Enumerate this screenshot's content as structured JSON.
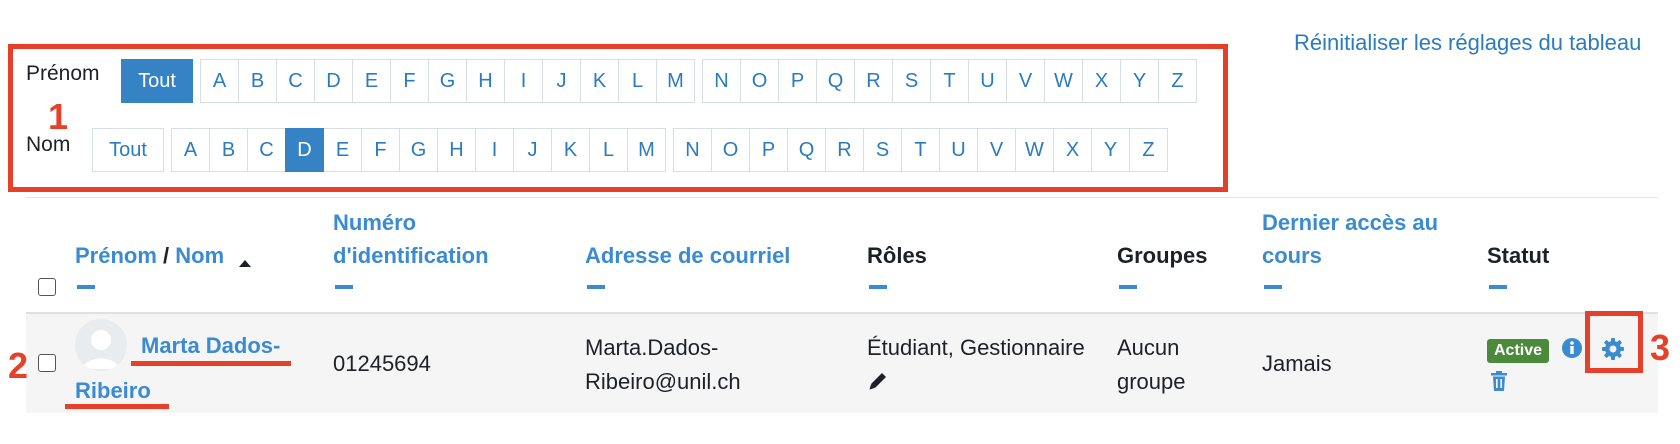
{
  "reset_link": "Réinitialiser les réglages du tableau",
  "filters": {
    "first_name": {
      "label": "Prénom",
      "tout": "Tout",
      "active": "Tout",
      "letters_a_m": [
        "A",
        "B",
        "C",
        "D",
        "E",
        "F",
        "G",
        "H",
        "I",
        "J",
        "K",
        "L",
        "M"
      ],
      "letters_n_z": [
        "N",
        "O",
        "P",
        "Q",
        "R",
        "S",
        "T",
        "U",
        "V",
        "W",
        "X",
        "Y",
        "Z"
      ]
    },
    "last_name": {
      "label": "Nom",
      "tout": "Tout",
      "active": "D",
      "letters_a_m": [
        "A",
        "B",
        "C",
        "D",
        "E",
        "F",
        "G",
        "H",
        "I",
        "J",
        "K",
        "L",
        "M"
      ],
      "letters_n_z": [
        "N",
        "O",
        "P",
        "Q",
        "R",
        "S",
        "T",
        "U",
        "V",
        "W",
        "X",
        "Y",
        "Z"
      ]
    }
  },
  "table": {
    "headers": {
      "prenom": "Prénom",
      "slash": "/",
      "nom": "Nom",
      "sort_icon": "sort-up-icon",
      "id_line1": "Numéro",
      "id_line2": "d'identification",
      "email": "Adresse de courriel",
      "roles": "Rôles",
      "groups": "Groupes",
      "last_access_line1": "Dernier accès au",
      "last_access_line2": "cours",
      "status": "Statut"
    },
    "row": {
      "name_line1": "Marta Dados-",
      "name_line2": "Ribeiro",
      "id_number": "01245694",
      "email_line1": "Marta.Dados-",
      "email_line2": "Ribeiro@unil.ch",
      "roles": "Étudiant, Gestionnaire",
      "groups_line1": "Aucun",
      "groups_line2": "groupe",
      "last_access": "Jamais",
      "status_badge": "Active",
      "icons": [
        "pencil-icon",
        "info-icon",
        "gear-icon",
        "trash-icon"
      ]
    }
  },
  "annotations": {
    "one": "1",
    "two": "2",
    "three": "3",
    "color": "#e4402a"
  },
  "colors": {
    "link": "#3a8bd0",
    "active_letter": "#3583c5",
    "badge_green": "#4a8a3a"
  }
}
